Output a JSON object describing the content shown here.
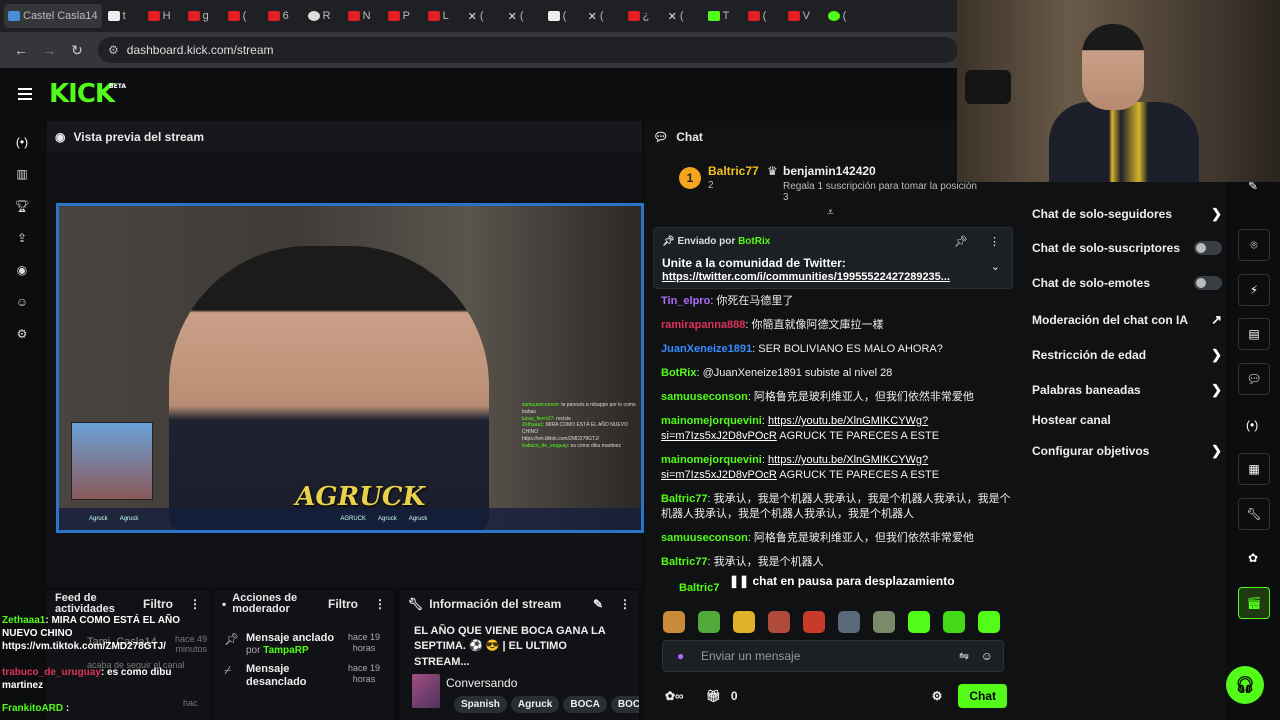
{
  "browser": {
    "tabs": [
      {
        "label": "Castel Casla14",
        "color": "#4a8bd8"
      },
      {
        "label": "t",
        "color": "#eee"
      },
      {
        "label": "H",
        "color": "#e02020"
      },
      {
        "label": "g",
        "color": "#e02020"
      },
      {
        "label": "(",
        "color": "#e02020"
      },
      {
        "label": "6",
        "color": "#e02020"
      },
      {
        "label": "R",
        "color": "#ddd"
      },
      {
        "label": "N",
        "color": "#e02020"
      },
      {
        "label": "P",
        "color": "#e02020"
      },
      {
        "label": "L",
        "color": "#e02020"
      },
      {
        "label": "(",
        "color": "#ddd"
      },
      {
        "label": "(",
        "color": "#ddd"
      },
      {
        "label": "(",
        "color": "#eee"
      },
      {
        "label": "(",
        "color": "#ddd"
      },
      {
        "label": "¿",
        "color": "#e02020"
      },
      {
        "label": "(",
        "color": "#ddd"
      },
      {
        "label": "T",
        "color": "#53fc18"
      },
      {
        "label": "(",
        "color": "#e02020"
      },
      {
        "label": "V",
        "color": "#e02020"
      },
      {
        "label": "(",
        "color": "#53fc18"
      }
    ],
    "url": "dashboard.kick.com/stream"
  },
  "header": {
    "logo": "KICK",
    "logo_tag": "BETA"
  },
  "preview": {
    "title": "Vista previa del stream",
    "overlay_name": "AGRUCK",
    "overlay_chat": [
      {
        "user": "samuuseconson",
        "text": ": te parecés a mbappe por lo como trabas"
      },
      {
        "user": "lucas_fierro27",
        "text": ": reciste"
      },
      {
        "user": "Zethaaa1",
        "text": ": MIRA COMO ESTÁ EL AÑO NUEVO CHINO"
      },
      {
        "user": "",
        "text": "https://vm.tiktok.com/ZMD278GTJ/"
      },
      {
        "user": "trabuco_de_uruguay",
        "text": ": es como dibu martinez"
      }
    ],
    "overlay_bar": [
      "Agruck",
      "Agruck",
      "AGRUCK",
      "Agruck",
      "Agruck"
    ]
  },
  "feed": {
    "title": "Feed de actividades",
    "filter": "Filtro",
    "messages": [
      {
        "user": "Zethaaa1",
        "text": ": MIRA COMO ESTÁ EL AÑO NUEVO CHINO https://vm.tiktok.com/ZMD278GTJ/"
      },
      {
        "user": "trabuco_de_uruguay",
        "text": ": es como dibu martinez"
      },
      {
        "user": "FrankitoARD",
        "text": " :"
      }
    ],
    "ghost": "Tami_Casla14",
    "ghost_time": "hace 49 minutos",
    "ghost_sub": "acaba de seguir el canal",
    "time2": "hac"
  },
  "mod_actions": {
    "title": "Acciones de moderador",
    "filter": "Filtro",
    "rows": [
      {
        "action": "Mensaje anclado",
        "by_prefix": "por",
        "by": "TampaRP",
        "when": "hace 19 horas"
      },
      {
        "action": "Mensaje desanclado",
        "by_prefix": "",
        "by": "",
        "when": "hace 19 horas"
      }
    ]
  },
  "stream_info": {
    "title_label": "Información del stream",
    "stream_title": "EL AÑO QUE VIENE BOCA GANA LA SEPTIMA. ⚽ 😎 | EL ULTIMO STREAM...",
    "category": "Conversando",
    "tags": [
      "Spanish",
      "Agruck",
      "BOCA",
      "BOC"
    ]
  },
  "chat": {
    "title": "Chat",
    "top_rank": "1",
    "top_user": "Baltric77",
    "top_count": "2",
    "second_user": "benjamin142420",
    "second_sub": "Regala 1 suscripción para tomar la posición 3",
    "pinned": {
      "sent_by_label": "Enviado por",
      "sent_by": "BotRix",
      "line1": "Unite a la comunidad de Twitter:",
      "link": "https://twitter.com/i/communities/19955522427289235..."
    },
    "messages": [
      {
        "user": "Tin_elpro",
        "color": "#b06bff",
        "text": ": 你死在马德里了",
        "link": ""
      },
      {
        "user": "ramirapanna888",
        "color": "#e0315a",
        "text": ": 你簡直就像阿德文庫拉一樣",
        "link": ""
      },
      {
        "user": "JuanXeneize1891",
        "color": "#3b8cff",
        "text": ": SER BOLIVIANO ES MALO AHORA?",
        "link": ""
      },
      {
        "user": "BotRix",
        "color": "#53fc18",
        "text": ": @JuanXeneize1891 subiste al nivel 28",
        "link": ""
      },
      {
        "user": "samuuseconson",
        "color": "#53fc18",
        "text": ": 阿格鲁克是玻利维亚人，但我们依然非常爱他",
        "link": ""
      },
      {
        "user": "mainomejorquevini",
        "color": "#53fc18",
        "text": " AGRUCK TE PARECES A ESTE",
        "link": "https://youtu.be/XlnGMIKCYWg?si=m7Izs5xJ2D8vPOcR"
      },
      {
        "user": "mainomejorquevini",
        "color": "#53fc18",
        "text": " AGRUCK TE PARECES A ESTE",
        "link": "https://youtu.be/XlnGMIKCYWg?si=m7Izs5xJ2D8vPOcR"
      },
      {
        "user": "Baltric77",
        "color": "#53fc18",
        "text": ": 我承认，我是个机器人我承认，我是个机器人我承认，我是个机器人我承认，我是个机器人我承认，我是个机器人",
        "link": ""
      },
      {
        "user": "samuuseconson",
        "color": "#53fc18",
        "text": ": 阿格鲁克是玻利维亚人，但我们依然非常爱他",
        "link": ""
      },
      {
        "user": "Baltric77",
        "color": "#53fc18",
        "text": ": 我承认，我是个机器人",
        "link": ""
      }
    ],
    "pause_text": "chat en pausa para desplazamiento",
    "last_partial": "Baltric7",
    "input_placeholder": "Enviar un mensaje",
    "footer_count": "0",
    "send_label": "Chat"
  },
  "settings": {
    "items": [
      {
        "label": "Chat de solo-seguidores",
        "kind": "chevron"
      },
      {
        "label": "Chat de solo-suscriptores",
        "kind": "toggle"
      },
      {
        "label": "Chat de solo-emotes",
        "kind": "toggle"
      },
      {
        "label": "Moderación del chat con IA",
        "kind": "external"
      },
      {
        "label": "Restricción de edad",
        "kind": "chevron"
      },
      {
        "label": "Palabras baneadas",
        "kind": "chevron"
      },
      {
        "label": "Hostear canal",
        "kind": "none"
      },
      {
        "label": "Configurar objetivos",
        "kind": "chevron"
      }
    ]
  },
  "colors": {
    "brand": "#53fc18",
    "bg": "#0b0d0f",
    "panel": "#101215"
  }
}
